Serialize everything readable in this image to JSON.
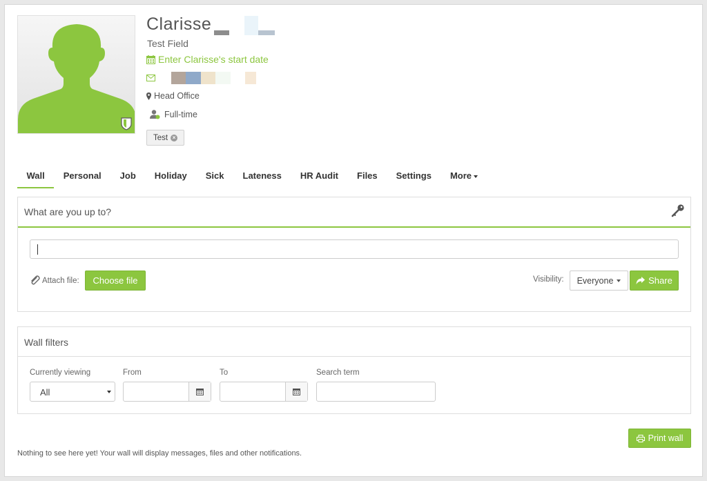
{
  "profile": {
    "first_name": "Clarisse",
    "job_title": "Test Field",
    "start_date_prompt": "Enter Clarisse's start date",
    "location": "Head Office",
    "employment_type": "Full-time",
    "tags": [
      {
        "label": "Test"
      }
    ]
  },
  "tabs": [
    {
      "label": "Wall",
      "active": true
    },
    {
      "label": "Personal"
    },
    {
      "label": "Job"
    },
    {
      "label": "Holiday"
    },
    {
      "label": "Sick"
    },
    {
      "label": "Lateness"
    },
    {
      "label": "HR Audit"
    },
    {
      "label": "Files"
    },
    {
      "label": "Settings"
    },
    {
      "label": "More"
    }
  ],
  "post": {
    "prompt": "What are you up to?",
    "input_value": "",
    "attach_label": "Attach file:",
    "choose_file_label": "Choose file",
    "visibility_label": "Visibility:",
    "visibility_value": "Everyone",
    "share_label": "Share"
  },
  "filters": {
    "title": "Wall filters",
    "viewing_label": "Currently viewing",
    "viewing_value": "All",
    "from_label": "From",
    "to_label": "To",
    "search_label": "Search term",
    "from_value": "",
    "to_value": "",
    "search_value": ""
  },
  "print_label": "Print wall",
  "empty_message": "Nothing to see here yet! Your wall will display messages, files and other notifications.",
  "colors": {
    "accent": "#8cc63f",
    "border": "#dddddd",
    "text": "#555555"
  },
  "icons": [
    "calendar-icon",
    "envelope-icon",
    "map-marker-icon",
    "user-icon",
    "key-icon",
    "paperclip-icon",
    "share-icon",
    "print-icon",
    "shield-icon"
  ]
}
